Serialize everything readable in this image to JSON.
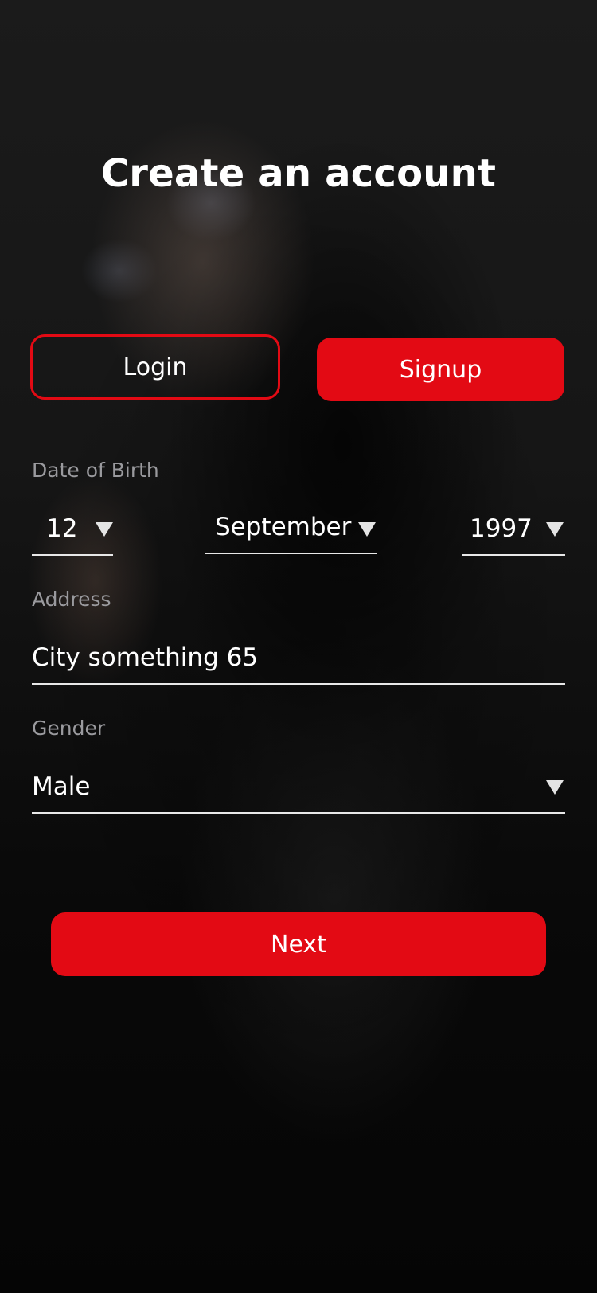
{
  "header": {
    "title": "Create an account"
  },
  "auth_tabs": {
    "login_label": "Login",
    "signup_label": "Signup"
  },
  "form": {
    "dob": {
      "label": "Date of Birth",
      "day": "12",
      "month": "September",
      "year": "1997"
    },
    "address": {
      "label": "Address",
      "value": "City something 65"
    },
    "gender": {
      "label": "Gender",
      "value": "Male"
    }
  },
  "actions": {
    "next_label": "Next"
  },
  "colors": {
    "accent": "#e30a14",
    "background": "#111111",
    "label_text": "#9a9a9e",
    "text": "#ffffff"
  },
  "icons": {
    "dropdown": "caret-down-icon"
  }
}
